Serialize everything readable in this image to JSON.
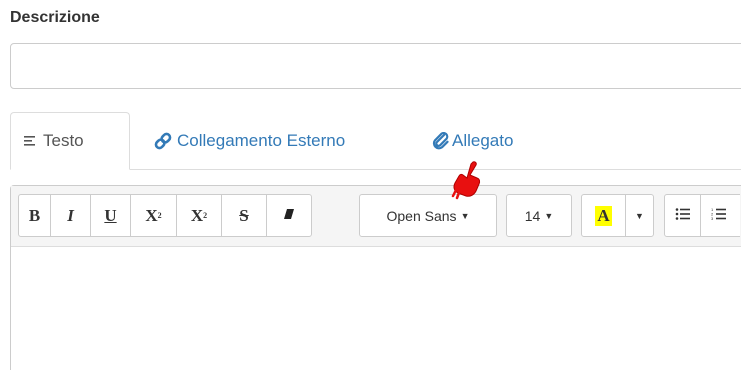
{
  "form": {
    "description_label": "Descrizione",
    "description_value": "",
    "description_placeholder": ""
  },
  "tabs": [
    {
      "label": "Testo",
      "icon": "align-left-icon",
      "active": true
    },
    {
      "label": "Collegamento Esterno",
      "icon": "link-icon",
      "active": false
    },
    {
      "label": "Allegato",
      "icon": "paperclip-icon",
      "active": false
    }
  ],
  "toolbar": {
    "bold": "B",
    "italic": "I",
    "underline": "U",
    "superscript": "X",
    "superscript_mark": "2",
    "subscript": "X",
    "subscript_mark": "2",
    "strikethrough": "S",
    "font_name": "Open Sans",
    "font_size": "14",
    "text_color": "A",
    "highlight_color": "#ffff00",
    "link_color": "#337ab7"
  },
  "cursor": {
    "icon": "hand-pointer-icon",
    "color": "#ee1111"
  }
}
